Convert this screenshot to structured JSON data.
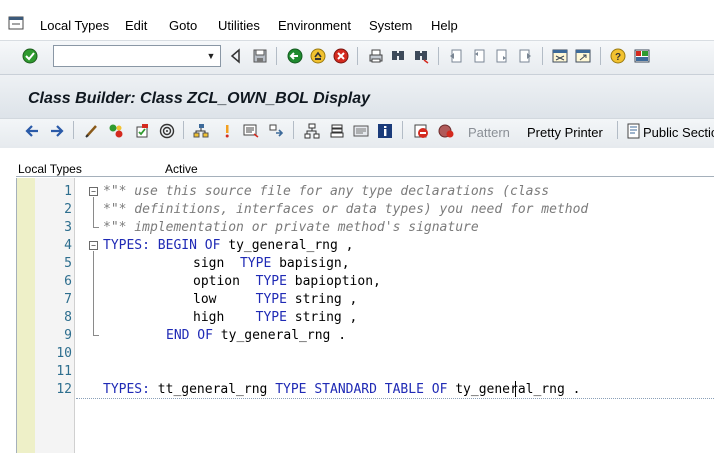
{
  "menu": {
    "items": [
      "Local Types",
      "Edit",
      "Goto",
      "Utilities",
      "Environment",
      "System",
      "Help"
    ],
    "mnemonics": [
      "o",
      "E",
      "G",
      "U",
      "n",
      "y",
      "H"
    ]
  },
  "toolbar": {
    "command_field_value": "",
    "icons": [
      "enter-checkmark-icon",
      "back-triangle-icon",
      "save-icon",
      "back-green-icon",
      "exit-icon",
      "cancel-icon",
      "print-icon",
      "find-icon",
      "find-next-icon",
      "first-page-icon",
      "previous-page-icon",
      "next-page-icon",
      "last-page-icon",
      "new-session-icon",
      "shortcut-icon",
      "help-icon",
      "customize-layout-icon"
    ]
  },
  "title": "Class Builder: Class ZCL_OWN_BOL Display",
  "app_toolbar": {
    "pattern_label": "Pattern",
    "pretty_printer_label": "Pretty Printer",
    "public_section_label": "Public Section"
  },
  "subheader": {
    "section_label": "Local Types",
    "status": "Active"
  },
  "editor": {
    "line_numbers": [
      "1",
      "2",
      "3",
      "4",
      "5",
      "6",
      "7",
      "8",
      "9",
      "10",
      "11",
      "12"
    ],
    "lines": [
      {
        "comment": "*\"* use this source file for any type declarations (class"
      },
      {
        "comment": "*\"* definitions, interfaces or data types) you need for method"
      },
      {
        "comment": "*\"* implementation or private method's signature"
      },
      {
        "kw1": "TYPES:",
        "kw2": "BEGIN OF",
        "rest": " ty_general_rng ,"
      },
      {
        "text": "sign  ",
        "kw": "TYPE",
        "rest": " bapisign,"
      },
      {
        "text": "option  ",
        "kw": "TYPE",
        "rest": " bapioption,"
      },
      {
        "text": "low     ",
        "kw": "TYPE",
        "rest": " string ,"
      },
      {
        "text": "high    ",
        "kw": "TYPE",
        "rest": " string ,"
      },
      {
        "kw": "END OF",
        "rest": " ty_general_rng ."
      },
      {},
      {},
      {
        "kw1": "TYPES:",
        "rest1": " tt_general_rng ",
        "kw2": "TYPE STANDARD TABLE OF",
        "rest2": " ty_general_rng ."
      }
    ]
  },
  "colors": {
    "keyword": "#1f2ab5",
    "comment": "#7b7b7b",
    "line_number": "#2d6e8e",
    "gutter": "#eef0c8"
  }
}
